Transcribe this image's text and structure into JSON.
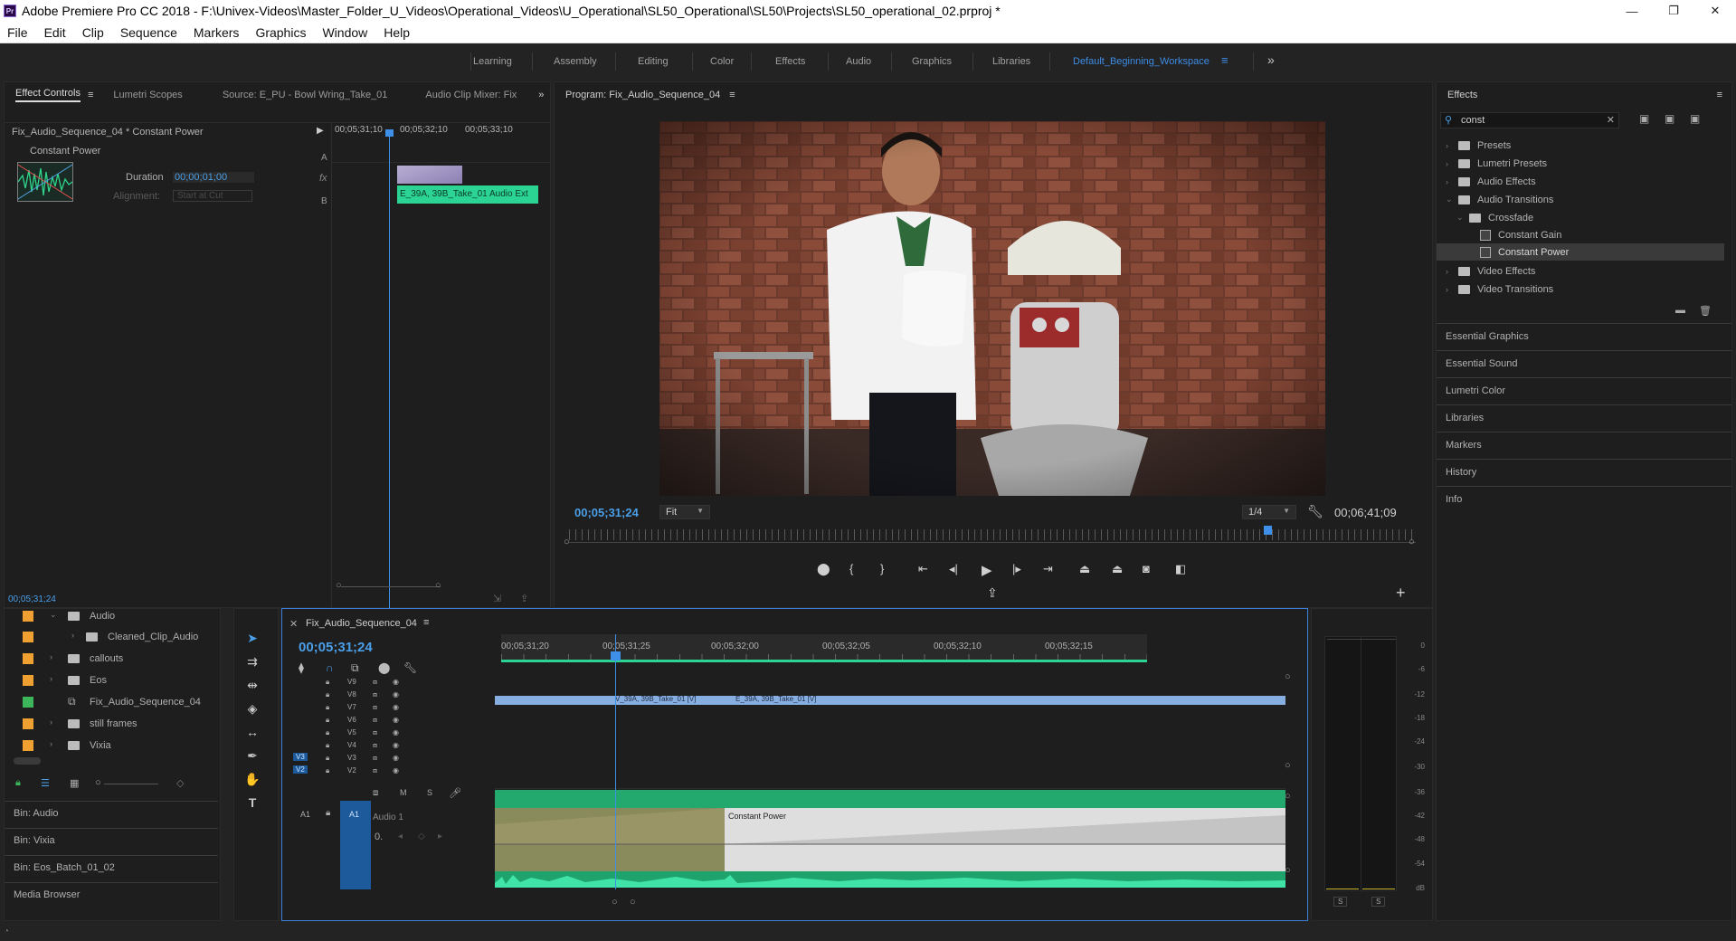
{
  "window": {
    "title": "Adobe Premiere Pro CC 2018 - F:\\Univex-Videos\\Master_Folder_U_Videos\\Operational_Videos\\U_Operational\\SL50_Operational\\SL50\\Projects\\SL50_operational_02.prproj *",
    "logo": "Pr",
    "controls": [
      "—",
      "❐",
      "✕"
    ]
  },
  "menu": [
    "File",
    "Edit",
    "Clip",
    "Sequence",
    "Markers",
    "Graphics",
    "Window",
    "Help"
  ],
  "workspaces": {
    "tabs": [
      "Learning",
      "Assembly",
      "Editing",
      "Color",
      "Effects",
      "Audio",
      "Graphics",
      "Libraries"
    ],
    "active": "Default_Beginning_Workspace"
  },
  "effect_controls": {
    "tabs": [
      "Effect Controls",
      "Lumetri Scopes",
      "Source: E_PU - Bowl Wring_Take_01",
      "Audio Clip Mixer: Fix"
    ],
    "sequence_label": "Fix_Audio_Sequence_04 * Constant Power",
    "effect_name": "Constant Power",
    "duration_label": "Duration",
    "duration_value": "00;00;01;00",
    "alignment_label": "Alignment:",
    "alignment_value": "Start at Cut",
    "timecodes": [
      "00;05;31;10",
      "00;05;32;10",
      "00;05;33;10"
    ],
    "track_a": "A",
    "track_b": "B",
    "clip_label": "E_39A, 39B_Take_01 Audio Ext",
    "current_time": "00;05;31;24"
  },
  "program": {
    "title": "Program: Fix_Audio_Sequence_04",
    "timecode_left": "00;05;31;24",
    "fit": "Fit",
    "resolution": "1/4",
    "timecode_right": "00;06;41;09"
  },
  "effects_panel": {
    "title": "Effects",
    "search_value": "const",
    "items": [
      {
        "label": "Presets",
        "level": 0,
        "type": "folder"
      },
      {
        "label": "Lumetri Presets",
        "level": 0,
        "type": "folder"
      },
      {
        "label": "Audio Effects",
        "level": 0,
        "type": "folder"
      },
      {
        "label": "Audio Transitions",
        "level": 0,
        "type": "folder",
        "open": true
      },
      {
        "label": "Crossfade",
        "level": 1,
        "type": "folder",
        "open": true
      },
      {
        "label": "Constant Gain",
        "level": 2,
        "type": "fx"
      },
      {
        "label": "Constant Power",
        "level": 2,
        "type": "fx",
        "selected": true
      },
      {
        "label": "Video Effects",
        "level": 0,
        "type": "folder"
      },
      {
        "label": "Video Transitions",
        "level": 0,
        "type": "folder"
      }
    ],
    "side_panels": [
      "Essential Graphics",
      "Essential Sound",
      "Lumetri Color",
      "Libraries",
      "Markers",
      "History",
      "Info"
    ]
  },
  "project": {
    "items": [
      {
        "label": "Audio",
        "color": "#f0a030",
        "level": 0
      },
      {
        "label": "Cleaned_Clip_Audio",
        "color": "#f0a030",
        "level": 1
      },
      {
        "label": "callouts",
        "color": "#f0a030",
        "level": 0
      },
      {
        "label": "Eos",
        "color": "#f0a030",
        "level": 0
      },
      {
        "label": "Fix_Audio_Sequence_04",
        "color": "#3db55a",
        "level": 0
      },
      {
        "label": "still frames",
        "color": "#f0a030",
        "level": 0
      },
      {
        "label": "Vixia",
        "color": "#f0a030",
        "level": 0
      }
    ],
    "bins": [
      "Bin: Audio",
      "Bin: Vixia",
      "Bin: Eos_Batch_01_02",
      "Media Browser"
    ]
  },
  "timeline": {
    "title": "Fix_Audio_Sequence_04",
    "timecode": "00;05;31;24",
    "ruler": [
      "00;05;31;20",
      "00;05;31;25",
      "00;05;32;00",
      "00;05;32;05",
      "00;05;32;10",
      "00;05;32;15"
    ],
    "video_tracks": [
      "V9",
      "V8",
      "V7",
      "V6",
      "V5",
      "V4",
      "V3",
      "V2"
    ],
    "src_targets": [
      "V3",
      "V2"
    ],
    "clip_v1": "V_39A, 39B_Take_01 [V]",
    "clip_v2": "E_39A, 39B_Take_01 [V]",
    "audio_track": "A1",
    "audio_src": "A1",
    "audio_name": "Audio 1",
    "audio_m": "M",
    "audio_s": "S",
    "volume": "0.",
    "transition_label": "Constant Power"
  },
  "meter": {
    "labels": [
      "0",
      "-6",
      "-12",
      "-18",
      "-24",
      "-30",
      "-36",
      "-42",
      "-48",
      "-54",
      "dB"
    ],
    "solo": [
      "S",
      "S"
    ]
  }
}
